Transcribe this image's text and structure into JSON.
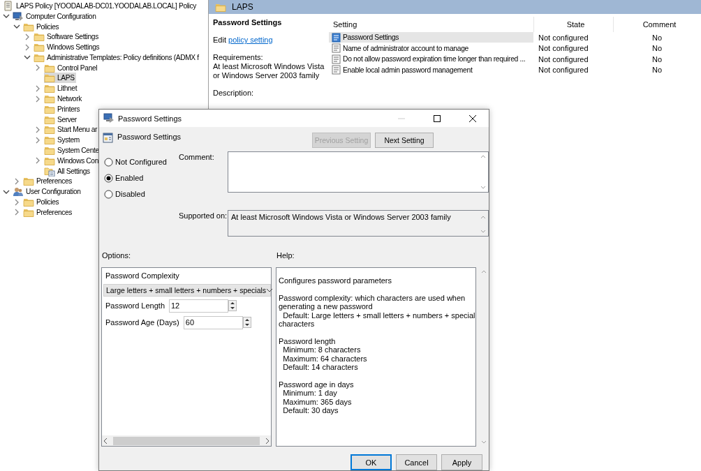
{
  "tree": {
    "items": [
      {
        "label": "LAPS Policy [YOODALAB-DC01.YOODALAB.LOCAL] Policy",
        "kind": "policy",
        "selected": false,
        "children": [
          {
            "label": "Computer Configuration",
            "kind": "computer",
            "expanded": true,
            "selected": false,
            "children": [
              {
                "label": "Policies",
                "kind": "folder",
                "expanded": true,
                "selected": false,
                "children": [
                  {
                    "label": "Software Settings",
                    "kind": "folder",
                    "expanded": false,
                    "selected": false
                  },
                  {
                    "label": "Windows Settings",
                    "kind": "folder",
                    "expanded": false,
                    "selected": false
                  },
                  {
                    "label": "Administrative Templates: Policy definitions (ADMX f",
                    "kind": "folder",
                    "expanded": true,
                    "selected": false,
                    "children": [
                      {
                        "label": "Control Panel",
                        "kind": "folder",
                        "expanded": false,
                        "selected": false
                      },
                      {
                        "label": "LAPS",
                        "kind": "folder",
                        "selected": true
                      },
                      {
                        "label": "Lithnet",
                        "kind": "folder",
                        "expanded": false,
                        "selected": false
                      },
                      {
                        "label": "Network",
                        "kind": "folder",
                        "expanded": false,
                        "selected": false
                      },
                      {
                        "label": "Printers",
                        "kind": "folder",
                        "selected": false
                      },
                      {
                        "label": "Server",
                        "kind": "folder",
                        "selected": false
                      },
                      {
                        "label": "Start Menu ar",
                        "kind": "folder",
                        "expanded": false,
                        "selected": false
                      },
                      {
                        "label": "System",
                        "kind": "folder",
                        "expanded": false,
                        "selected": false
                      },
                      {
                        "label": "System Cente",
                        "kind": "folder",
                        "selected": false
                      },
                      {
                        "label": "Windows Con",
                        "kind": "folder",
                        "expanded": false,
                        "selected": false
                      },
                      {
                        "label": "All Settings",
                        "kind": "all-settings",
                        "selected": false
                      }
                    ]
                  }
                ]
              },
              {
                "label": "Preferences",
                "kind": "folder",
                "expanded": false,
                "selected": false
              }
            ]
          },
          {
            "label": "User Configuration",
            "kind": "users",
            "expanded": true,
            "selected": false,
            "children": [
              {
                "label": "Policies",
                "kind": "folder",
                "expanded": false,
                "selected": false
              },
              {
                "label": "Preferences",
                "kind": "folder",
                "expanded": false,
                "selected": false
              }
            ]
          }
        ]
      }
    ]
  },
  "folder_header": {
    "title": "LAPS"
  },
  "description": {
    "title": "Password Settings",
    "edit_prefix": "Edit",
    "edit_link": "policy setting",
    "requirements_label": "Requirements:",
    "requirements": "At least Microsoft Windows Vista or Windows Server 2003 family",
    "description_label": "Description:"
  },
  "table": {
    "columns": [
      "Setting",
      "State",
      "Comment"
    ],
    "rows": [
      {
        "setting": "Password Settings",
        "state": "Not configured",
        "comment": "No",
        "selected": true
      },
      {
        "setting": "Name of administrator account to manage",
        "state": "Not configured",
        "comment": "No",
        "selected": false
      },
      {
        "setting": "Do not allow password expiration time longer than required ...",
        "state": "Not configured",
        "comment": "No",
        "selected": false
      },
      {
        "setting": "Enable local admin password management",
        "state": "Not configured",
        "comment": "No",
        "selected": false
      }
    ]
  },
  "dialog": {
    "title": "Password Settings",
    "heading": "Password Settings",
    "nav_buttons": [
      {
        "label": "Previous Setting",
        "disabled": true
      },
      {
        "label": "Next Setting",
        "disabled": false
      }
    ],
    "radios": [
      {
        "label": "Not Configured",
        "selected": false
      },
      {
        "label": "Enabled",
        "selected": true
      },
      {
        "label": "Disabled",
        "selected": false
      }
    ],
    "comment_label": "Comment:",
    "supported_label": "Supported on:",
    "supported_value": "At least Microsoft Windows Vista or Windows Server 2003 family",
    "options_label": "Options:",
    "help_label": "Help:",
    "option_fields": [
      {
        "kind": "label",
        "label": "Password Complexity"
      },
      {
        "kind": "dropdown",
        "value": "Large letters + small letters + numbers + specials"
      },
      {
        "kind": "spinner",
        "label": "Password Length",
        "value": "12"
      },
      {
        "kind": "spinner",
        "label": "Password Age (Days)",
        "value": "60"
      }
    ],
    "help": [
      "Configures password parameters",
      "Password complexity: which characters are used when generating a new password\n  Default: Large letters + small letters + numbers + special characters",
      "Password length\n  Minimum: 8 characters\n  Maximum: 64 characters\n  Default: 14 characters",
      "Password age in days\n  Minimum: 1 day\n  Maximum: 365 days\n  Default: 30 days"
    ],
    "buttons": [
      {
        "label": "OK",
        "default": true
      },
      {
        "label": "Cancel",
        "default": false
      },
      {
        "label": "Apply",
        "default": false
      }
    ]
  }
}
